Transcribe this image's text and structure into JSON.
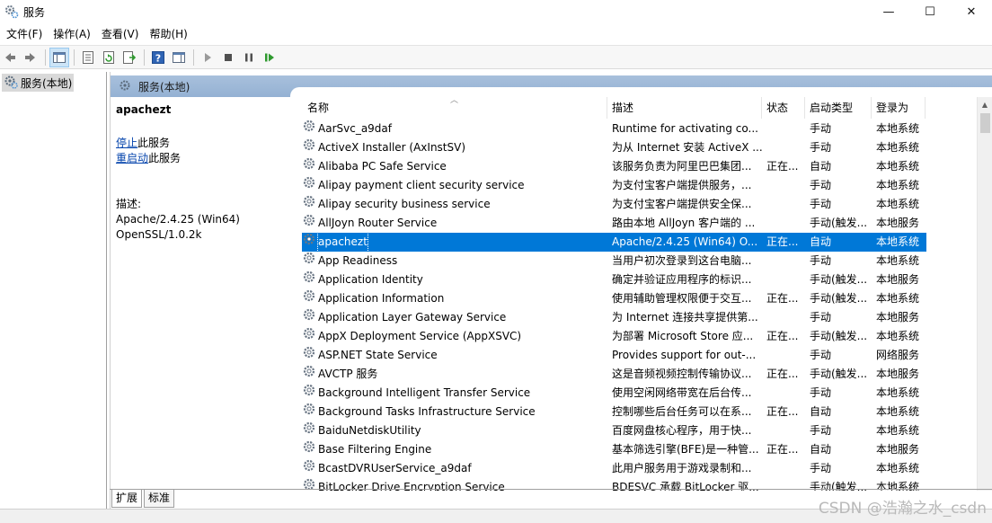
{
  "window": {
    "title": "服务",
    "controls": {
      "minimize": "—",
      "maximize": "☐",
      "close": "✕"
    }
  },
  "menu": [
    "文件(F)",
    "操作(A)",
    "查看(V)",
    "帮助(H)"
  ],
  "tree": {
    "root_label": "服务(本地)"
  },
  "pane": {
    "header": "服务(本地)",
    "selected_name": "apachezt",
    "action_stop_link": "停止",
    "action_stop_suffix": "此服务",
    "action_restart_link": "重启动",
    "action_restart_suffix": "此服务",
    "desc_label": "描述:",
    "desc_text": "Apache/2.4.25 (Win64)\nOpenSSL/1.0.2k"
  },
  "columns": {
    "name": "名称",
    "desc": "描述",
    "status": "状态",
    "startup": "启动类型",
    "logon": "登录为"
  },
  "rows": [
    {
      "name": "AarSvc_a9daf",
      "desc": "Runtime for activating co...",
      "status": "",
      "startup": "手动",
      "logon": "本地系统"
    },
    {
      "name": "ActiveX Installer (AxInstSV)",
      "desc": "为从 Internet 安装 ActiveX ...",
      "status": "",
      "startup": "手动",
      "logon": "本地系统"
    },
    {
      "name": "Alibaba PC Safe Service",
      "desc": "该服务负责为阿里巴巴集团...",
      "status": "正在...",
      "startup": "自动",
      "logon": "本地系统"
    },
    {
      "name": "Alipay payment client security service",
      "desc": "为支付宝客户端提供服务，...",
      "status": "",
      "startup": "手动",
      "logon": "本地系统"
    },
    {
      "name": "Alipay security business service",
      "desc": "为支付宝客户端提供安全保...",
      "status": "",
      "startup": "手动",
      "logon": "本地系统"
    },
    {
      "name": "AllJoyn Router Service",
      "desc": "路由本地 AllJoyn 客户端的 ...",
      "status": "",
      "startup": "手动(触发...",
      "logon": "本地服务"
    },
    {
      "name": "apachezt",
      "desc": "Apache/2.4.25 (Win64) O...",
      "status": "正在...",
      "startup": "自动",
      "logon": "本地系统",
      "selected": true
    },
    {
      "name": "App Readiness",
      "desc": "当用户初次登录到这台电脑...",
      "status": "",
      "startup": "手动",
      "logon": "本地系统"
    },
    {
      "name": "Application Identity",
      "desc": "确定并验证应用程序的标识...",
      "status": "",
      "startup": "手动(触发...",
      "logon": "本地服务"
    },
    {
      "name": "Application Information",
      "desc": "使用辅助管理权限便于交互...",
      "status": "正在...",
      "startup": "手动(触发...",
      "logon": "本地系统"
    },
    {
      "name": "Application Layer Gateway Service",
      "desc": "为 Internet 连接共享提供第...",
      "status": "",
      "startup": "手动",
      "logon": "本地服务"
    },
    {
      "name": "AppX Deployment Service (AppXSVC)",
      "desc": "为部署 Microsoft Store 应...",
      "status": "正在...",
      "startup": "手动(触发...",
      "logon": "本地系统"
    },
    {
      "name": "ASP.NET State Service",
      "desc": "Provides support for out-...",
      "status": "",
      "startup": "手动",
      "logon": "网络服务"
    },
    {
      "name": "AVCTP 服务",
      "desc": "这是音频视频控制传输协议...",
      "status": "正在...",
      "startup": "手动(触发...",
      "logon": "本地服务"
    },
    {
      "name": "Background Intelligent Transfer Service",
      "desc": "使用空闲网络带宽在后台传...",
      "status": "",
      "startup": "手动",
      "logon": "本地系统"
    },
    {
      "name": "Background Tasks Infrastructure Service",
      "desc": "控制哪些后台任务可以在系...",
      "status": "正在...",
      "startup": "自动",
      "logon": "本地系统"
    },
    {
      "name": "BaiduNetdiskUtility",
      "desc": "百度网盘核心程序，用于快...",
      "status": "",
      "startup": "手动",
      "logon": "本地系统"
    },
    {
      "name": "Base Filtering Engine",
      "desc": "基本筛选引擎(BFE)是一种管...",
      "status": "正在...",
      "startup": "自动",
      "logon": "本地服务"
    },
    {
      "name": "BcastDVRUserService_a9daf",
      "desc": "此用户服务用于游戏录制和...",
      "status": "",
      "startup": "手动",
      "logon": "本地系统"
    },
    {
      "name": "BitLocker Drive Encryption Service",
      "desc": "BDESVC 承载 BitLocker 驱...",
      "status": "",
      "startup": "手动(触发...",
      "logon": "本地系统"
    }
  ],
  "tabs": [
    "扩展",
    "标准"
  ],
  "watermark": "CSDN @浩瀚之水_csdn"
}
